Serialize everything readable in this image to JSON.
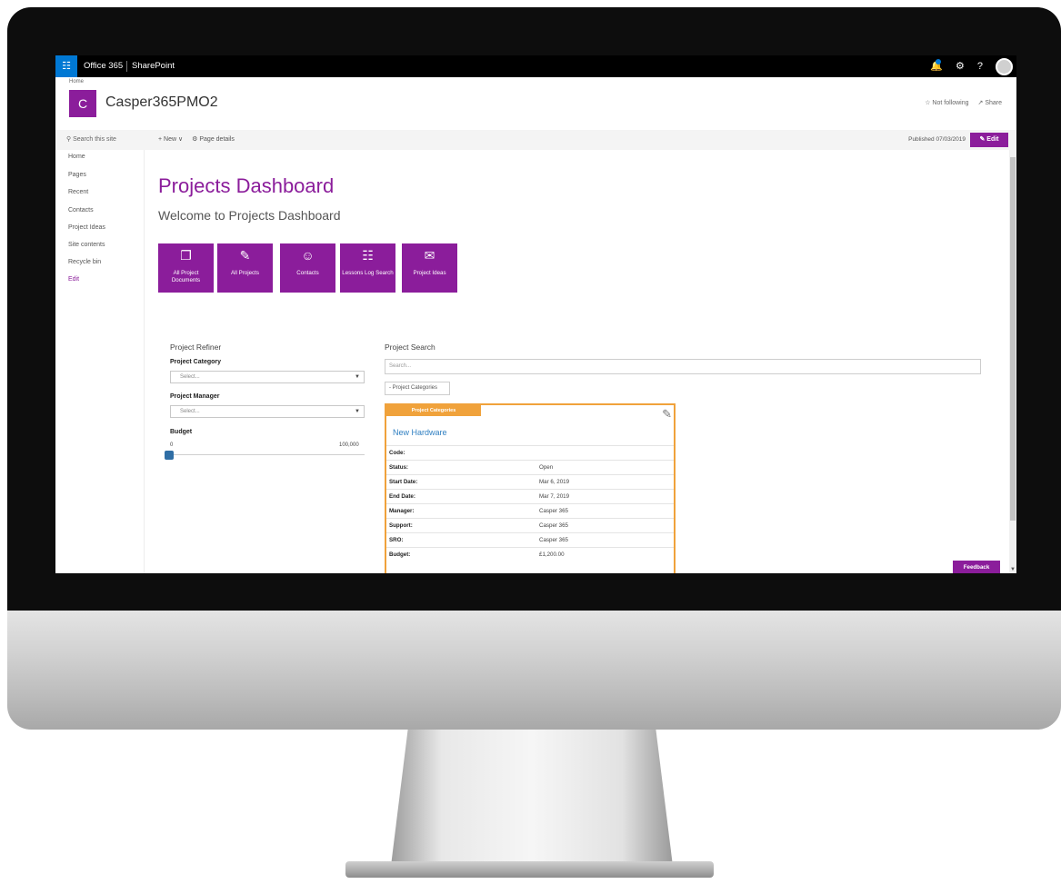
{
  "suite_bar": {
    "brand": "Office 365",
    "app": "SharePoint",
    "icons": [
      "waffle-icon",
      "bell-icon",
      "gear-icon",
      "help-icon",
      "avatar"
    ],
    "help_label": "?"
  },
  "site": {
    "breadcrumb": "Home",
    "logo_letter": "C",
    "title": "Casper365PMO2",
    "follow_label": "Not following",
    "share_label": "Share"
  },
  "command_bar": {
    "search_placeholder": "Search this site",
    "new_label": "New",
    "page_details_label": "Page details",
    "published_label": "Published 07/03/2019",
    "edit_label": "Edit"
  },
  "left_nav": {
    "items": [
      "Home",
      "Pages",
      "Recent",
      "Contacts",
      "Project Ideas",
      "Site contents",
      "Recycle bin",
      "Edit"
    ]
  },
  "page": {
    "title": "Projects Dashboard",
    "subtitle": "Welcome to Projects Dashboard"
  },
  "tiles": [
    {
      "label": "All Project Documents",
      "icon": "documents-icon"
    },
    {
      "label": "All Projects",
      "icon": "clipboard-icon"
    },
    {
      "label": "Contacts",
      "icon": "person-icon"
    },
    {
      "label": "Lessons Log Search",
      "icon": "document-search-icon"
    },
    {
      "label": "Project Ideas",
      "icon": "chat-icon"
    }
  ],
  "refiner": {
    "title": "Project Refiner",
    "category_label": "Project Category",
    "category_value": "Select...",
    "manager_label": "Project Manager",
    "manager_value": "Select...",
    "budget_label": "Budget",
    "budget_min": "0",
    "budget_max": "100,000"
  },
  "search": {
    "title": "Project Search",
    "placeholder": "Search...",
    "toggle_label": "- Project Categories"
  },
  "project_card": {
    "tag": "Project Categories",
    "title": "New Hardware",
    "rows": [
      {
        "key": "Code:",
        "value": ""
      },
      {
        "key": "Status:",
        "value": "Open"
      },
      {
        "key": "Start Date:",
        "value": "Mar 6, 2019"
      },
      {
        "key": "End Date:",
        "value": "Mar 7, 2019"
      },
      {
        "key": "Manager:",
        "value": "Casper 365"
      },
      {
        "key": "Support:",
        "value": "Casper 365"
      },
      {
        "key": "SRO:",
        "value": "Casper 365"
      },
      {
        "key": "Budget:",
        "value": "£1,200.00"
      }
    ]
  },
  "feedback_label": "Feedback",
  "colors": {
    "accent": "#8b1d9b",
    "suite_bar": "#000000",
    "waffle": "#0078d4",
    "card_border": "#f0a23b",
    "link": "#2f7fc1"
  }
}
